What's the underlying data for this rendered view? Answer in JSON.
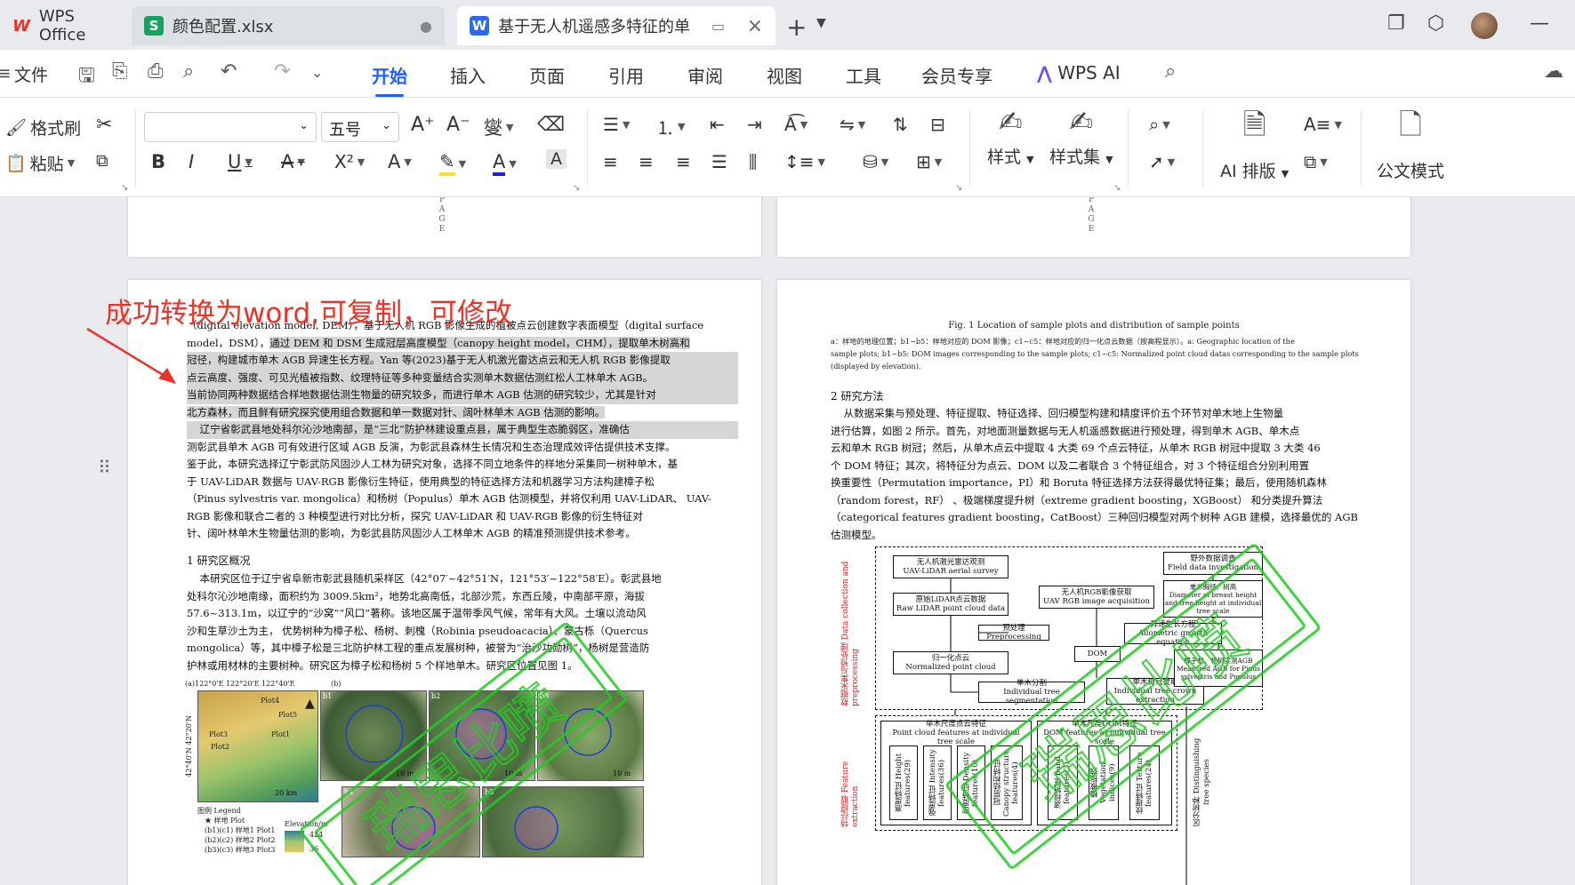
{
  "tabs": [
    {
      "label": "WPS Office",
      "icon": "wps-logo-icon"
    },
    {
      "label": "颜色配置.xlsx",
      "icon": "spreadsheet-icon",
      "icon_text": "S"
    },
    {
      "label": "基于无人机遥感多特征的单",
      "icon": "word-doc-icon",
      "icon_text": "W"
    }
  ],
  "menu": {
    "file": "文件",
    "items": [
      "开始",
      "插入",
      "页面",
      "引用",
      "审阅",
      "视图",
      "工具",
      "会员专享"
    ],
    "active": "开始",
    "wps_ai": "WPS AI"
  },
  "ribbon": {
    "format_painter": "格式刷",
    "paste": "粘贴",
    "font_name": "",
    "font_size": "五号",
    "styles": "样式",
    "style_set": "样式集",
    "ai_layout": "AI 排版",
    "official_doc": "公文模式"
  },
  "colors": {
    "accent": "#1f5eff",
    "annotation_red": "#e8342a",
    "watermark_green": "#22cc22",
    "figure_red_text": "#d12020"
  },
  "page_vertical_text": "P\nA\nG\nE",
  "annotation": "成功转换为word,可复制，可修改",
  "left_page": {
    "para1": [
      "（digital elevation model, DEM），基于无人机 RGB 影像生成的植被点云创建数字表面模型（digital surface",
      "model，DSM），通过 DEM 和 DSM 生成冠层高度模型（canopy height model，CHM），提取单木树高和",
      "冠径，构建城市单木 AGB 异速生长方程。Yan 等(2023)基于无人机激光雷达点云和无人机 RGB 影像提取",
      "点云高度、强度、可见光植被指数、纹理特征等多种变量结合实测单木数据估测红松人工林单木 AGB。",
      "当前协同两种数据结合样地数据估测生物量的研究较多，而进行单木 AGB 估测的研究较少，尤其是针对",
      "北方森林，而且鲜有研究探究使用组合数据和单一数据对针、阔叶林单木 AGB 估测的影响。"
    ],
    "para2": [
      "    辽宁省彰武县地处科尔沁沙地南部，是“三北”防护林建设重点县，属于典型生态脆弱区，准确估",
      "测彰武县单木 AGB 可有效进行区域 AGB 反演，为彰武县森林生长情况和生态治理成效评估提供技术支撑。",
      "鉴于此，本研究选择辽宁彰武防风固沙人工林为研究对象，选择不同立地条件的样地分采集同一树种单木，基",
      "于 UAV-LiDAR 数据与 UAV-RGB 影像衍生特征，使用典型的特征选择方法和机器学习方法构建樟子松",
      "（Pinus sylvestris var. mongolica）和杨树（Populus）单木 AGB 估测模型，并将仅利用 UAV-LiDAR、 UAV-",
      "RGB 影像和联合二者的 3 种模型进行对比分析，探究 UAV-LiDAR 和 UAV-RGB 影像的衍生特征对",
      "针、阔叶林单木生物量估测的影响，为彰武县防风固沙人工林单木 AGB 的精准预测提供技术参考。"
    ],
    "heading1": "1 研究区概况",
    "para3": [
      "    本研究区位于辽宁省阜新市彰武县随机采样区（42°07′~42°51′N，121°53′~122°58′E）。彰武县地",
      "处科尔沁沙地南缘，面积约为 3009.5km²，地势北高南低，北部沙荒，东西丘陵，中南部平原，海拔",
      "57.6~313.1m，以辽宁的“沙窝”“风口”著称。该地区属于温带季风气候，常年有大风。土壤以流动风",
      "沙和生草沙土为主， 优势树种为樟子松、杨树、刺槐（Robinia pseudoacacia）、蒙古栎（Quercus",
      "mongolica）等，其中樟子松是三北防护林工程的重点发展树种，被誉为“治沙功勋树”，杨树是营造防",
      "护林或用材林的主要树种。研究区为樟子松和杨树 5 个样地单木。研究区位置见图 1。"
    ],
    "figure": {
      "axis_top": "(a)122°0'E      122°20'E    122°40'E",
      "axis_left": "42°40'N      42°20'N",
      "plots": [
        "Plot4",
        "Plot5",
        "Plot3",
        "Plot2",
        "Plot1"
      ],
      "scale_km": "20 km",
      "scale_m": "10 m",
      "panel_labels": [
        "(b)",
        "b1",
        "b2",
        "b3",
        "b4",
        "b5"
      ],
      "legend_title": "图例 Legend",
      "legend_items": [
        "★ 样地 Plot",
        "(b1)(c1) 样地1 Plot1",
        "(b2)(c2) 样地2 Plot2",
        "(b3)(c3) 样地3 Plot3"
      ],
      "elevation_title": "Elevation/m",
      "elevation_values": [
        "424",
        "36"
      ]
    }
  },
  "right_page": {
    "fig_caption": "Fig. 1 Location of sample plots and distribution of sample points",
    "caption_lines": [
      "a：样地的地理位置；b1~b5：样地对应的 DOM 影像；c1~c5：样地对应的归一化点云数据（按高程显示）。a: Geographic location of the",
      "sample plots; b1~b5: DOM images corresponding to the sample plots; c1~c5: Normalized point cloud datas corresponding to the sample plots",
      "(displayed by elevation)."
    ],
    "heading2": "2 研究方法",
    "para": [
      "    从数据采集与预处理、特征提取、特征选择、回归模型构建和精度评价五个环节对单木地上生物量",
      "进行估算，如图 2 所示。首先，对地面测量数据与无人机遥感数据进行预处理，得到单木 AGB、单木点",
      "云和单木 RGB 树冠；然后，从单木点云中提取 4 大类 69 个点云特征，从单木 RGB 树冠中提取 3 大类 46",
      "个 DOM 特征；其次，将特征分为点云、DOM 以及二者联合 3 个特征组合，对 3 个特征组合分别利用置",
      "换重要性（Permutation importance，PI）和 Boruta 特征选择方法获得最优特征集；最后，使用随机森林",
      "（random forest，RF）  、极端梯度提升树（extreme gradient boosting，XGBoost） 和分类提升算法",
      "（categorical features gradient boosting，CatBoost）三种回归模型对两个树种 AGB 建模，选择最优的 AGB",
      "估测模型。"
    ],
    "flow": {
      "side_label_1": "数据采集与预处理 Data collection and preprocessing",
      "side_label_2": "特征提取 Feature extraction",
      "boxes": [
        {
          "cn": "无人机激光雷达观测",
          "en": "UAV-LiDAR aerial survey"
        },
        {
          "cn": "原始LiDAR点云数据",
          "en": "Raw LiDAR point cloud data"
        },
        {
          "cn": "预处理Preprocessing",
          "en": ""
        },
        {
          "cn": "归一化点云",
          "en": "Normalized point cloud"
        },
        {
          "cn": "单木分割",
          "en": "Individual tree segmentation"
        },
        {
          "cn": "无人机RGB影像获取",
          "en": "UAV RGB image acquisition"
        },
        {
          "cn": "DOM",
          "en": ""
        },
        {
          "cn": "单木树冠提取",
          "en": "Individual tree crown extraction"
        },
        {
          "cn": "野外数据调查",
          "en": "Field data investigation"
        },
        {
          "cn": "单木胸径、树高",
          "en": "Diameter at breast height and tree height at individual tree scale"
        },
        {
          "cn": "异速生长方程",
          "en": "Allometric growth equation"
        },
        {
          "cn": "樟子松、杨树实测AGB",
          "en": "Measured AGB for Pinus sylvestris and Populus"
        }
      ],
      "group_pc": {
        "cn": "单木尺度点云特征",
        "en": "Point cloud features at individual tree scale"
      },
      "group_dom": {
        "cn": "单木尺度DOM特征",
        "en": "DOM features at individual tree scale"
      },
      "pc_features": [
        "高度特征 Height features(29)",
        "强度特征 Intensity features(36)",
        "密度特征 Density features(10)",
        "冠层结构特征 Canopy structure features(4)"
      ],
      "dom_features": [
        "波段特征 Band features(3)",
        "植被指数 Vegetation indices(9)",
        "纹理特征 Texture features(24)"
      ],
      "species_label": "区分树种 Distinguishing tree species"
    }
  },
  "watermark_text": "瑞思比喷"
}
